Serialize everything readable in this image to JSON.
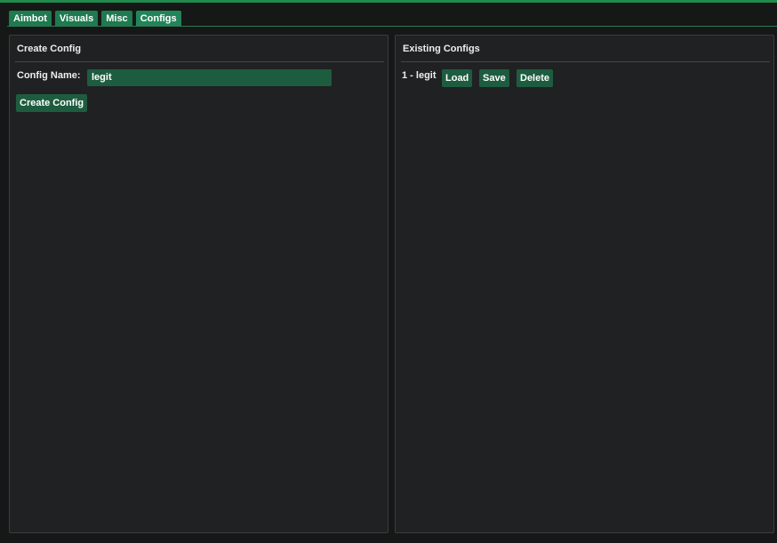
{
  "tabs": [
    {
      "label": "Aimbot",
      "active": false
    },
    {
      "label": "Visuals",
      "active": false
    },
    {
      "label": "Misc",
      "active": false
    },
    {
      "label": "Configs",
      "active": true
    }
  ],
  "create_panel": {
    "title": "Create Config",
    "name_label": "Config Name:",
    "name_value": "legit",
    "create_button": "Create Config"
  },
  "existing_panel": {
    "title": "Existing Configs",
    "configs": [
      {
        "label": "1 - legit",
        "load": "Load",
        "save": "Save",
        "delete": "Delete"
      }
    ]
  },
  "colors": {
    "accent": "#1e7a4f",
    "button": "#1e5c3f",
    "panel": "#202123"
  }
}
